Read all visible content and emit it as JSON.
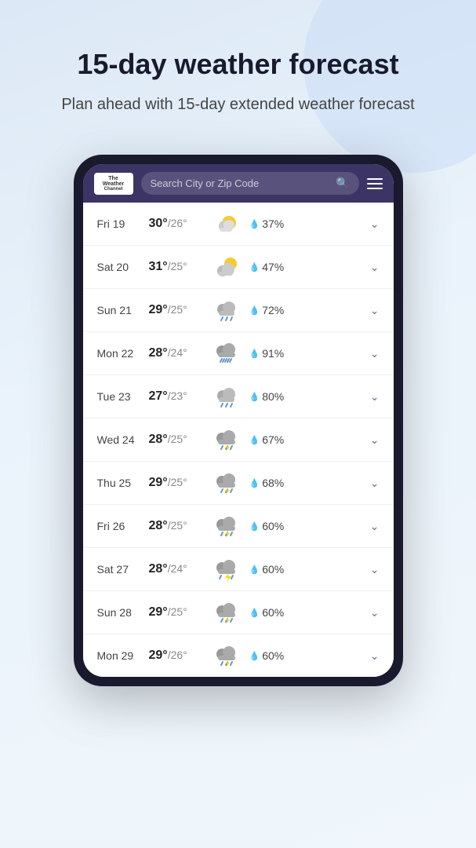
{
  "hero": {
    "title": "15-day weather forecast",
    "subtitle": "Plan ahead with 15-day extended weather forecast"
  },
  "phone": {
    "header": {
      "logo_line1": "The",
      "logo_line2": "Weather",
      "logo_line3": "Channel",
      "search_placeholder": "Search City or Zip Code",
      "menu_label": "Menu"
    },
    "forecast": [
      {
        "day": "Fri 19",
        "high": "30°",
        "low": "26°",
        "icon": "sunny-partly",
        "precip": "37%",
        "id": "fri19"
      },
      {
        "day": "Sat 20",
        "high": "31°",
        "low": "25°",
        "icon": "sunny-cloudy",
        "precip": "47%",
        "id": "sat20"
      },
      {
        "day": "Sun 21",
        "high": "29°",
        "low": "25°",
        "icon": "cloudy-rain",
        "precip": "72%",
        "id": "sun21"
      },
      {
        "day": "Mon 22",
        "high": "28°",
        "low": "24°",
        "icon": "storm-heavy",
        "precip": "91%",
        "id": "mon22"
      },
      {
        "day": "Tue 23",
        "high": "27°",
        "low": "23°",
        "icon": "cloudy-rain",
        "precip": "80%",
        "id": "tue23"
      },
      {
        "day": "Wed 24",
        "high": "28°",
        "low": "25°",
        "icon": "storm-rain",
        "precip": "67%",
        "id": "wed24"
      },
      {
        "day": "Thu 25",
        "high": "29°",
        "low": "25°",
        "icon": "storm-rain",
        "precip": "68%",
        "id": "thu25"
      },
      {
        "day": "Fri 26",
        "high": "28°",
        "low": "25°",
        "icon": "storm-rain",
        "precip": "60%",
        "id": "fri26"
      },
      {
        "day": "Sat 27",
        "high": "28°",
        "low": "24°",
        "icon": "storm-lightning",
        "precip": "60%",
        "id": "sat27"
      },
      {
        "day": "Sun 28",
        "high": "29°",
        "low": "25°",
        "icon": "storm-rain",
        "precip": "60%",
        "id": "sun28"
      },
      {
        "day": "Mon 29",
        "high": "29°",
        "low": "26°",
        "icon": "storm-rain",
        "precip": "60%",
        "id": "mon29"
      }
    ],
    "precip_symbol": "💧",
    "chevron": "∨"
  },
  "colors": {
    "bg_gradient_start": "#dce8f5",
    "bg_gradient_end": "#f0f6fb",
    "phone_bg": "#1a1a2e",
    "header_bg": "#3d3466",
    "accent_blue": "#5a7fa0"
  }
}
